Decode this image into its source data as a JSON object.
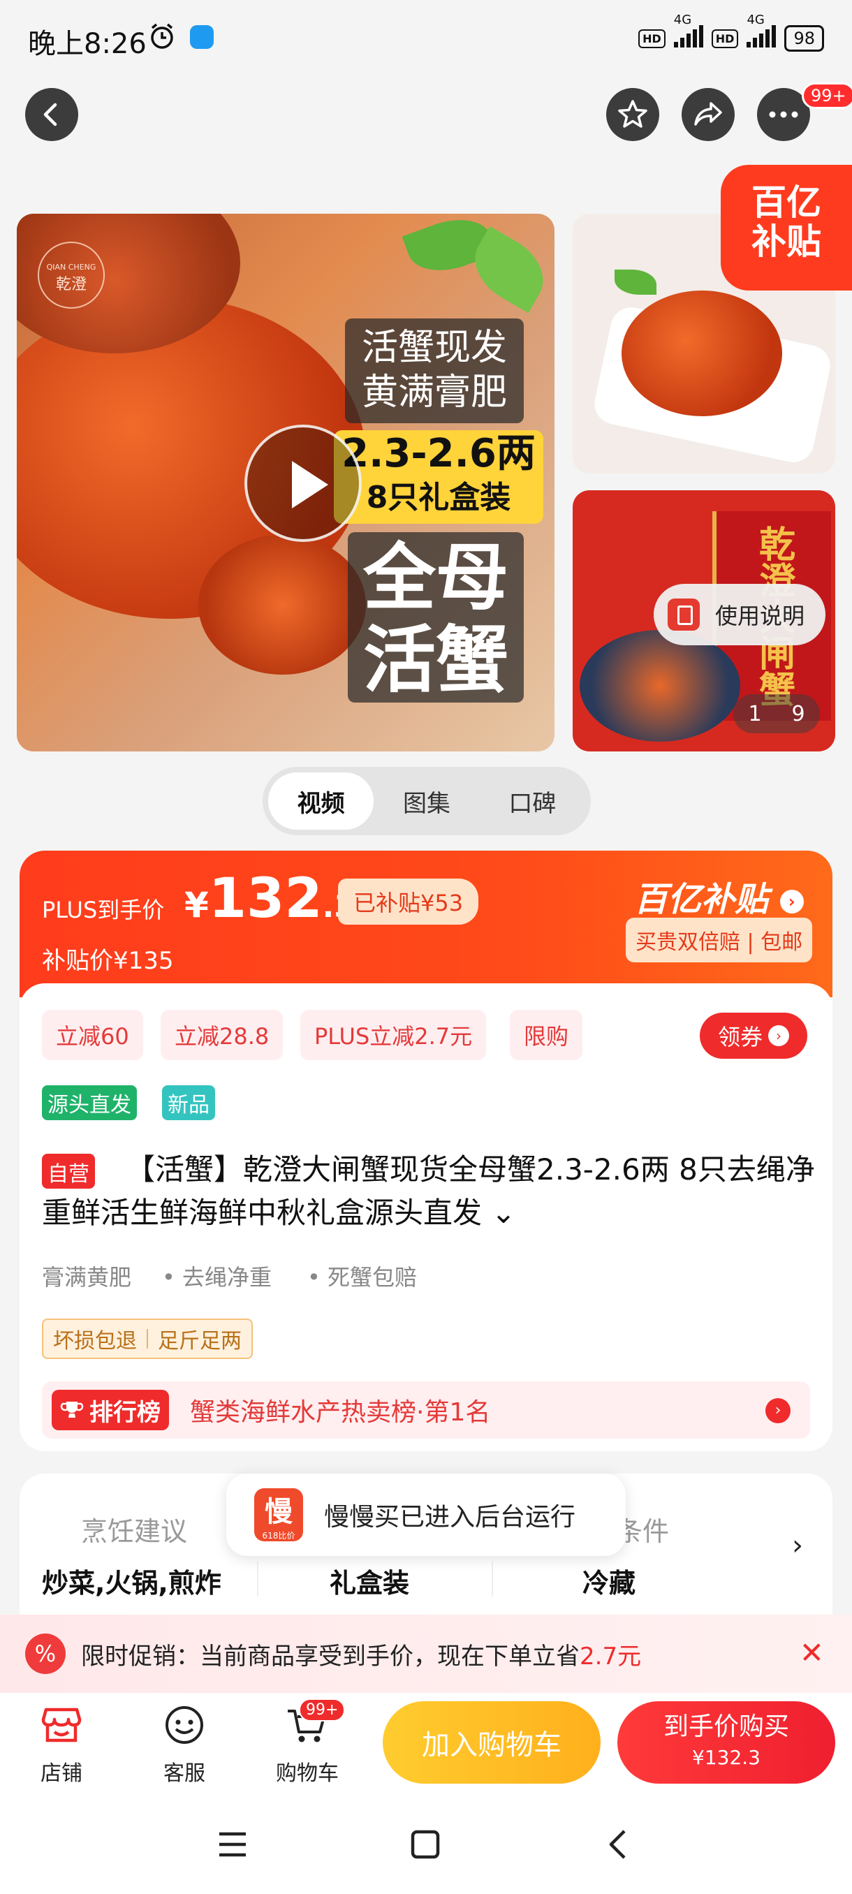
{
  "status_bar": {
    "time": "晚上8:26",
    "network_1": "4G",
    "network_2": "4G",
    "hd": "HD",
    "battery": "98"
  },
  "top_nav": {
    "more_badge": "99+"
  },
  "gallery": {
    "brand_small": "QIAN CHENG",
    "brand_cn": "乾澄",
    "overlay_line1": "活蟹现发",
    "overlay_line2": "黄满膏肥",
    "weight_line": "2.3-2.6两",
    "pack_line": "8只礼盒装",
    "big_line1": "全母",
    "big_line2": "活蟹",
    "subsidy_corner_1": "百亿",
    "subsidy_corner_2": "补贴",
    "box_text": "乾澄大闸蟹",
    "manual_label": "使用说明",
    "page_current": "1",
    "page_total": "9"
  },
  "media_tabs": [
    {
      "label": "视频"
    },
    {
      "label": "图集"
    },
    {
      "label": "口碑"
    }
  ],
  "price": {
    "plus_label": "PLUS到手价",
    "currency": "¥",
    "integer": "132",
    "decimal": ".3",
    "subsidized": "已补贴¥53",
    "sub_price": "补贴价¥135",
    "brand_subsidy": "百亿补贴",
    "brand_tag": "买贵双倍赔 | 包邮"
  },
  "coupons": [
    {
      "label": "立减60"
    },
    {
      "label": "立减28.8"
    },
    {
      "label": "PLUS立减2.7元"
    },
    {
      "label": "限购"
    }
  ],
  "get_coupon": "领券",
  "tags": [
    {
      "label": "源头直发"
    },
    {
      "label": "新品"
    }
  ],
  "self_operated": "自营",
  "title": "【活蟹】乾澄大闸蟹现货全母蟹2.3-2.6两 8只去绳净重鲜活生鲜海鲜中秋礼盒源头直发 ⌄",
  "features": [
    {
      "label": "膏满黄肥"
    },
    {
      "label": "• 去绳净重"
    },
    {
      "label": "• 死蟹包赔"
    }
  ],
  "service_tags": [
    {
      "label": "坏损包退"
    },
    {
      "label": "足斤足两"
    }
  ],
  "rank": {
    "badge": "排行榜",
    "text": "蟹类海鲜水产热卖榜·第1名"
  },
  "attributes": {
    "headers": [
      "烹饪建议",
      "",
      "条件"
    ],
    "values": [
      "炒菜,火锅,煎炸",
      "礼盒装",
      "冷藏"
    ]
  },
  "toast": {
    "logo": "慢",
    "logo_sub": "618比价",
    "text": "慢慢买已进入后台运行"
  },
  "promo": {
    "text_prefix": "限时促销：当前商品享受到手价，现在下单立省",
    "amount": "2.7元"
  },
  "bottom_bar": {
    "shop": "店铺",
    "service": "客服",
    "cart": "购物车",
    "cart_badge": "99+",
    "add_cart": "加入购物车",
    "buy_now": "到手价购买",
    "buy_price": "¥132.3"
  }
}
